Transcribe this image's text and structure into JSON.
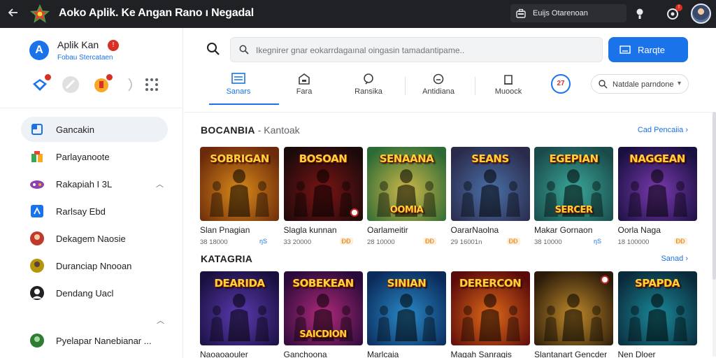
{
  "window": {
    "back_icon": "arrow-left-icon",
    "title": "Aoko Aplik. Ke Angan Rano ı Negadal",
    "account_chip": "Euijs Otarenoan",
    "alert_icon": "alert-icon",
    "notif_badge": "!",
    "avatar": "user-avatar"
  },
  "sidebar": {
    "app_logo": "A",
    "app_name": "Aplik Kan",
    "app_badge": "!",
    "app_subtitle": "Fobau Stercataen",
    "items": [
      {
        "label": "Gancakin",
        "icon": "bookmark-icon",
        "color": "#1a73e8"
      },
      {
        "label": "Parlayanoote",
        "icon": "puzzle-icon",
        "color": "#34a853"
      },
      {
        "label": "Rakapiah I 3L",
        "icon": "game-controller-icon",
        "color": "#8e44ad"
      },
      {
        "label": "Rarlsay Ebd",
        "icon": "tag-icon",
        "color": "#1a73e8"
      },
      {
        "label": "Dekagem Naosie",
        "icon": "avatar-red-icon",
        "color": "#c0392b"
      },
      {
        "label": "Duranciap Nnooan",
        "icon": "avatar-gold-icon",
        "color": "#b7950b"
      },
      {
        "label": "Dendang Uacl",
        "icon": "person-icon",
        "color": "#202124"
      },
      {
        "label": "Pyelapar Nanebianar ...",
        "icon": "avatar-green-icon",
        "color": "#2e7d32"
      }
    ]
  },
  "main": {
    "search": {
      "placeholder": "Ikegnirer gnar eokarrdagaınal oingasin tamadantipame..",
      "button_label": "Rarqte"
    },
    "tabs": [
      {
        "label": "Sanars",
        "icon": "list-icon"
      },
      {
        "label": "Fara",
        "icon": "house-icon"
      },
      {
        "label": "Ransika",
        "icon": "chat-icon"
      },
      {
        "label": "Antidiana",
        "icon": "badge-icon"
      },
      {
        "label": "Muoock",
        "icon": "bag-icon"
      }
    ],
    "brand_badge": "27",
    "filter": {
      "label": "Natdale parndone"
    },
    "section1": {
      "title": "BOCANBIA",
      "subtitle": "- Kantoak",
      "link": "Cad Pencaiia"
    },
    "section2": {
      "title": "KATAGRIA",
      "link": "Sanad"
    },
    "row1": [
      {
        "name": "Slan Pnagian",
        "meta": "38 18000",
        "tag": "ŋS",
        "tag_type": "blue",
        "art_top": "SOBRIGAN",
        "art_bottom": "",
        "c1": "#d98a1a",
        "c2": "#6b2a0a"
      },
      {
        "name": "Slagla kunnan",
        "meta": "33 20000",
        "tag": "ĐĐ",
        "tag_type": "orange",
        "art_top": "BOSOAN",
        "art_bottom": "",
        "c1": "#7a1414",
        "c2": "#1a0a0a"
      },
      {
        "name": "Oarlameitir",
        "meta": "28 10000",
        "tag": "ĐĐ",
        "tag_type": "orange",
        "art_top": "SENAANA",
        "art_bottom": "OOMIA",
        "c1": "#d0b84a",
        "c2": "#2d6b35"
      },
      {
        "name": "OararNaolna",
        "meta": "29 16001n",
        "tag": "ĐĐ",
        "tag_type": "orange",
        "art_top": "SEANS",
        "art_bottom": "",
        "c1": "#4a70a8",
        "c2": "#2a2a4a"
      },
      {
        "name": "Makar Gornaon",
        "meta": "38 10000",
        "tag": "ŋS",
        "tag_type": "blue",
        "art_top": "EGEPIAN",
        "art_bottom": "SERCER",
        "c1": "#3aa89a",
        "c2": "#1a4a4a"
      },
      {
        "name": "Oorla Naga",
        "meta": "18 100000",
        "tag": "ĐĐ",
        "tag_type": "orange",
        "art_top": "NAGGEAN",
        "art_bottom": "",
        "c1": "#7a3ab0",
        "c2": "#1a1040"
      }
    ],
    "row2": [
      {
        "name": "Naoaoaouler",
        "art_top": "DEARIDA",
        "art_bottom": "",
        "c1": "#5a3ab0",
        "c2": "#1a1040"
      },
      {
        "name": "Ganchoona",
        "art_top": "SOBEKEAN",
        "art_bottom": "SAICDION",
        "c1": "#b02a7a",
        "c2": "#2a0a3a"
      },
      {
        "name": "Marlcaia",
        "art_top": "SINIAN",
        "art_bottom": "",
        "c1": "#2a8ac8",
        "c2": "#0a2a5a"
      },
      {
        "name": "Magah Sanragis",
        "art_top": "DERERCON",
        "art_bottom": "",
        "c1": "#e06a1a",
        "c2": "#5a0a0a"
      },
      {
        "name": "Slantanart Gencder",
        "art_top": "",
        "art_bottom": "",
        "c1": "#c08a2a",
        "c2": "#2a1a0a"
      },
      {
        "name": "Nen Dloer",
        "art_top": "SPAPDA",
        "art_bottom": "",
        "c1": "#1a8a9a",
        "c2": "#0a2a3a"
      }
    ]
  }
}
